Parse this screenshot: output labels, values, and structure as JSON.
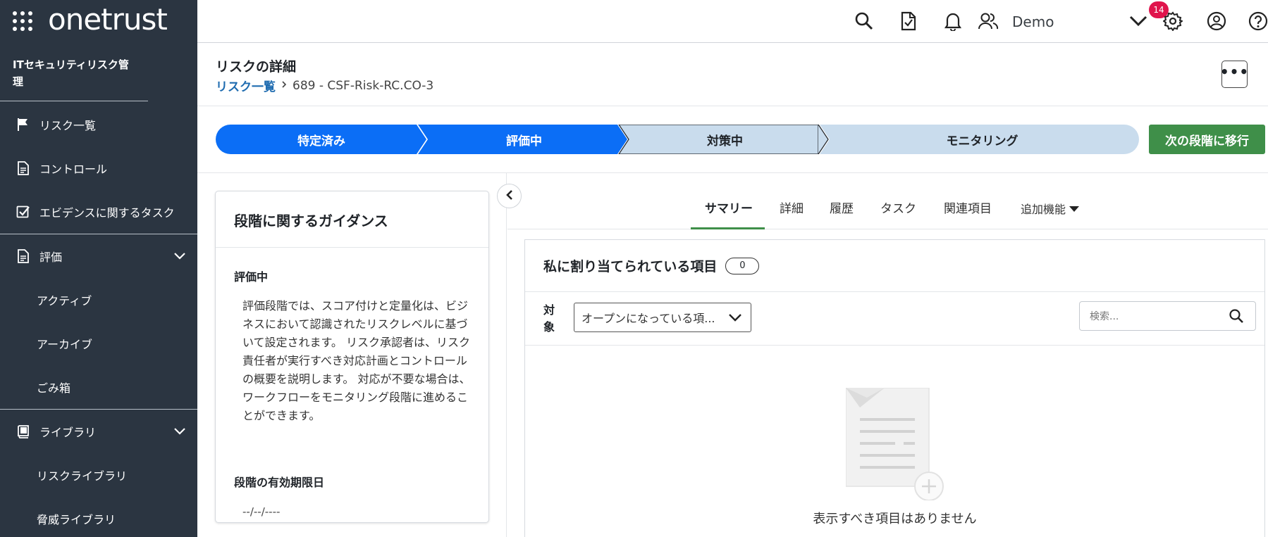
{
  "sidebar": {
    "brand": "onetrust",
    "app_title": "ITセキュリティリスク管理",
    "items": [
      {
        "label": "リスク一覧",
        "icon": "flag-icon"
      },
      {
        "label": "コントロール",
        "icon": "document-icon"
      },
      {
        "label": "エビデンスに関するタスク",
        "icon": "checkbox-icon"
      },
      {
        "label": "評価",
        "icon": "document-icon"
      },
      {
        "label": "アクティブ"
      },
      {
        "label": "アーカイブ"
      },
      {
        "label": "ごみ箱"
      },
      {
        "label": "ライブラリ",
        "icon": "book-icon"
      },
      {
        "label": "リスクライブラリ"
      },
      {
        "label": "脅威ライブラリ"
      }
    ]
  },
  "topbar": {
    "notification_count": "14",
    "user_name": "Demo"
  },
  "header": {
    "title": "リスクの詳細",
    "breadcrumb_link": "リスク一覧",
    "breadcrumb_current": "689 - CSF-Risk-RC.CO-3",
    "more_label": "•••"
  },
  "stages": [
    {
      "label": "特定済み",
      "state": "complete"
    },
    {
      "label": "評価中",
      "state": "complete"
    },
    {
      "label": "対策中",
      "state": "current"
    },
    {
      "label": "モニタリング",
      "state": "upcoming"
    }
  ],
  "next_stage_button": "次の段階に移行",
  "colors": {
    "sidebar_bg": "#2b3541",
    "stage_complete": "#0b6ef6",
    "stage_upcoming": "#c9dced",
    "next_button": "#3f8f49",
    "badge": "#e0144c",
    "link": "#1f6cb0"
  },
  "guidance": {
    "title": "段階に関するガイダンス",
    "stage_name": "評価中",
    "text": "評価段階では、スコア付けと定量化は、ビジネスにおいて認識されたリスクレベルに基づいて設定されます。 リスク承認者は、リスク責任者が実行すべき対応計画とコントロールの概要を説明します。 対応が不要な場合は、ワークフローをモニタリング段階に進めることができます。",
    "expiry_label": "段階の有効期限日",
    "expiry_value": "--/--/----"
  },
  "tabs": [
    {
      "label": "サマリー",
      "active": true
    },
    {
      "label": "詳細"
    },
    {
      "label": "履歴"
    },
    {
      "label": "タスク"
    },
    {
      "label": "関連項目"
    },
    {
      "label": "追加機能"
    }
  ],
  "assigned": {
    "title": "私に割り当てられている項目",
    "count": "0",
    "filter_label": "対象",
    "filter_value": "オープンになっている項...",
    "search_placeholder": "検索...",
    "empty_text": "表示すべき項目はありません"
  }
}
